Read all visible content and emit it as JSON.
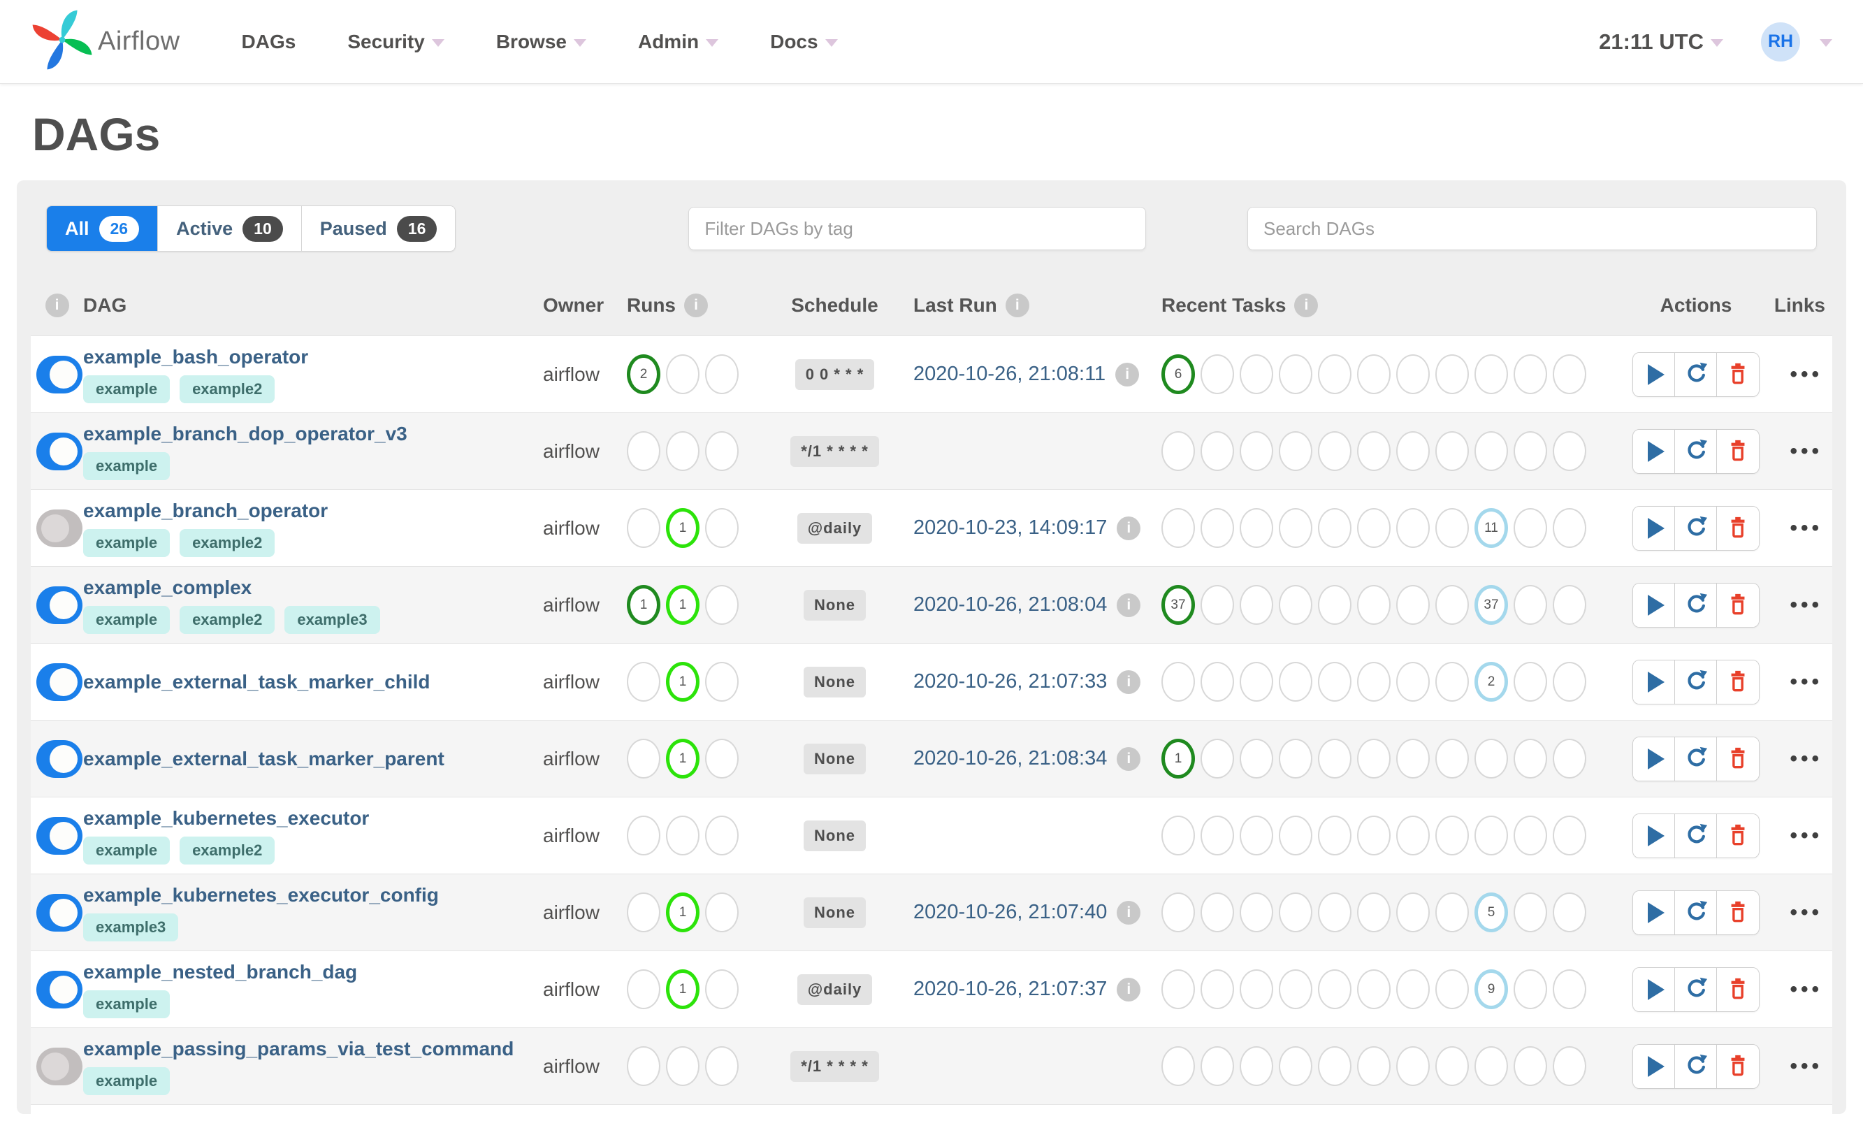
{
  "navbar": {
    "brand": "Airflow",
    "items": [
      {
        "label": "DAGs",
        "caret": false
      },
      {
        "label": "Security",
        "caret": true
      },
      {
        "label": "Browse",
        "caret": true
      },
      {
        "label": "Admin",
        "caret": true
      },
      {
        "label": "Docs",
        "caret": true
      }
    ],
    "clock": "21:11 UTC",
    "avatar_initials": "RH"
  },
  "page": {
    "title": "DAGs"
  },
  "tabs": [
    {
      "label": "All",
      "count": "26",
      "active": true
    },
    {
      "label": "Active",
      "count": "10",
      "active": false
    },
    {
      "label": "Paused",
      "count": "16",
      "active": false
    }
  ],
  "filters": {
    "tag_placeholder": "Filter DAGs by tag",
    "search_placeholder": "Search DAGs"
  },
  "table": {
    "headers": {
      "dag": "DAG",
      "owner": "Owner",
      "runs": "Runs",
      "schedule": "Schedule",
      "last_run": "Last Run",
      "recent_tasks": "Recent Tasks",
      "actions": "Actions",
      "links": "Links"
    },
    "runs_slots": 3,
    "recent_slots": 11,
    "rows": [
      {
        "name": "example_bash_operator",
        "tags": [
          "example",
          "example2"
        ],
        "enabled": true,
        "owner": "airflow",
        "runs": [
          {
            "slot": 1,
            "count": "2",
            "state": "success"
          }
        ],
        "schedule": "0 0 * * *",
        "last_run": "2020-10-26, 21:08:11",
        "recent": [
          {
            "slot": 1,
            "count": "6",
            "state": "success"
          }
        ]
      },
      {
        "name": "example_branch_dop_operator_v3",
        "tags": [
          "example"
        ],
        "enabled": true,
        "owner": "airflow",
        "runs": [],
        "schedule": "*/1 * * * *",
        "last_run": "",
        "recent": []
      },
      {
        "name": "example_branch_operator",
        "tags": [
          "example",
          "example2"
        ],
        "enabled": false,
        "owner": "airflow",
        "runs": [
          {
            "slot": 2,
            "count": "1",
            "state": "running"
          }
        ],
        "schedule": "@daily",
        "last_run": "2020-10-23, 14:09:17",
        "recent": [
          {
            "slot": 9,
            "count": "11",
            "state": "none"
          }
        ]
      },
      {
        "name": "example_complex",
        "tags": [
          "example",
          "example2",
          "example3"
        ],
        "enabled": true,
        "owner": "airflow",
        "runs": [
          {
            "slot": 1,
            "count": "1",
            "state": "success"
          },
          {
            "slot": 2,
            "count": "1",
            "state": "running"
          }
        ],
        "schedule": "None",
        "last_run": "2020-10-26, 21:08:04",
        "recent": [
          {
            "slot": 1,
            "count": "37",
            "state": "success"
          },
          {
            "slot": 9,
            "count": "37",
            "state": "none"
          }
        ]
      },
      {
        "name": "example_external_task_marker_child",
        "tags": [],
        "enabled": true,
        "owner": "airflow",
        "runs": [
          {
            "slot": 2,
            "count": "1",
            "state": "running"
          }
        ],
        "schedule": "None",
        "last_run": "2020-10-26, 21:07:33",
        "recent": [
          {
            "slot": 9,
            "count": "2",
            "state": "none"
          }
        ]
      },
      {
        "name": "example_external_task_marker_parent",
        "tags": [],
        "enabled": true,
        "owner": "airflow",
        "runs": [
          {
            "slot": 2,
            "count": "1",
            "state": "running"
          }
        ],
        "schedule": "None",
        "last_run": "2020-10-26, 21:08:34",
        "recent": [
          {
            "slot": 1,
            "count": "1",
            "state": "success"
          }
        ]
      },
      {
        "name": "example_kubernetes_executor",
        "tags": [
          "example",
          "example2"
        ],
        "enabled": true,
        "owner": "airflow",
        "runs": [],
        "schedule": "None",
        "last_run": "",
        "recent": []
      },
      {
        "name": "example_kubernetes_executor_config",
        "tags": [
          "example3"
        ],
        "enabled": true,
        "owner": "airflow",
        "runs": [
          {
            "slot": 2,
            "count": "1",
            "state": "running"
          }
        ],
        "schedule": "None",
        "last_run": "2020-10-26, 21:07:40",
        "recent": [
          {
            "slot": 9,
            "count": "5",
            "state": "none"
          }
        ]
      },
      {
        "name": "example_nested_branch_dag",
        "tags": [
          "example"
        ],
        "enabled": true,
        "owner": "airflow",
        "runs": [
          {
            "slot": 2,
            "count": "1",
            "state": "running"
          }
        ],
        "schedule": "@daily",
        "last_run": "2020-10-26, 21:07:37",
        "recent": [
          {
            "slot": 9,
            "count": "9",
            "state": "none"
          }
        ]
      },
      {
        "name": "example_passing_params_via_test_command",
        "tags": [
          "example"
        ],
        "enabled": false,
        "owner": "airflow",
        "runs": [],
        "schedule": "*/1 * * * *",
        "last_run": "",
        "recent": []
      }
    ]
  },
  "colors": {
    "accent_blue": "#1a7fea",
    "state_success": "#1f8a1f",
    "state_running": "#2ce30a",
    "state_none": "#a4d8ec",
    "empty_circle": "#d8d8d8",
    "danger_red": "#e8402a",
    "action_navy": "#2e6da4",
    "link_navy": "#3a6186",
    "tag_bg": "#cdf2ef",
    "logo_red": "#ec4133",
    "logo_teal": "#35cbd6",
    "logo_green": "#07be53",
    "logo_blue": "#2377e0"
  }
}
